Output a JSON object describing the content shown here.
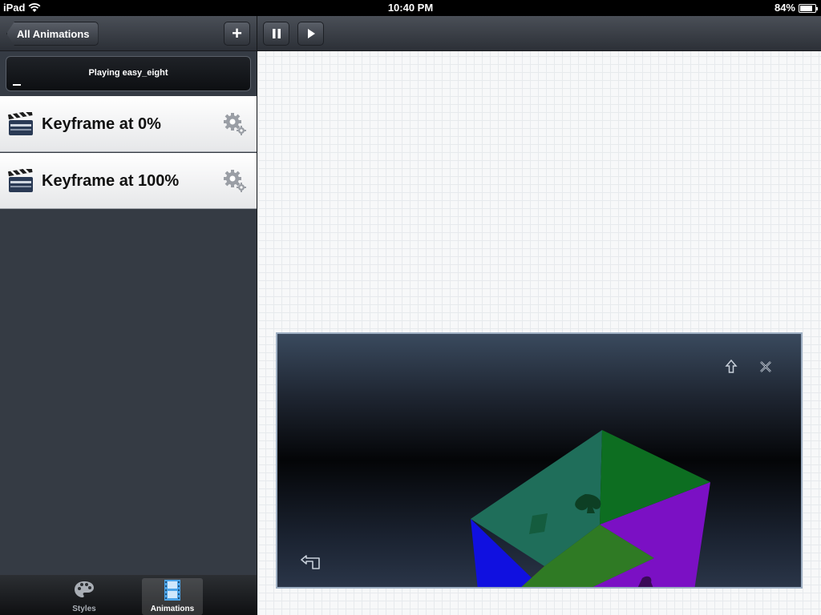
{
  "status_bar": {
    "device": "iPad",
    "time": "10:40 PM",
    "battery_percent": "84%",
    "battery_level": 0.84
  },
  "left_nav": {
    "back_label": "All Animations",
    "add_label": "+"
  },
  "player": {
    "status_text": "Playing easy_eight",
    "progress": 0.03
  },
  "keyframes": [
    {
      "label": "Keyframe at 0%",
      "icon": "clapperboard-icon",
      "action_icon": "gear-icon"
    },
    {
      "label": "Keyframe at 100%",
      "icon": "clapperboard-icon",
      "action_icon": "gear-icon"
    }
  ],
  "tabs": [
    {
      "label": "Styles",
      "icon": "palette-icon",
      "active": false
    },
    {
      "label": "Animations",
      "icon": "film-icon",
      "active": true
    }
  ],
  "toolbar": {
    "pause_icon": "pause-icon",
    "play_icon": "play-icon"
  },
  "preview": {
    "icons": [
      "arrow-up-icon",
      "close-icon",
      "rotate-back-icon"
    ]
  },
  "colors": {
    "face_top": "#1f6e5a",
    "face_right": "#0d6e21",
    "face_front_right": "#7b10c4",
    "face_left": "#1010e0",
    "face_bottom": "#9a1010",
    "face_bottom_green": "#2f7a24"
  }
}
